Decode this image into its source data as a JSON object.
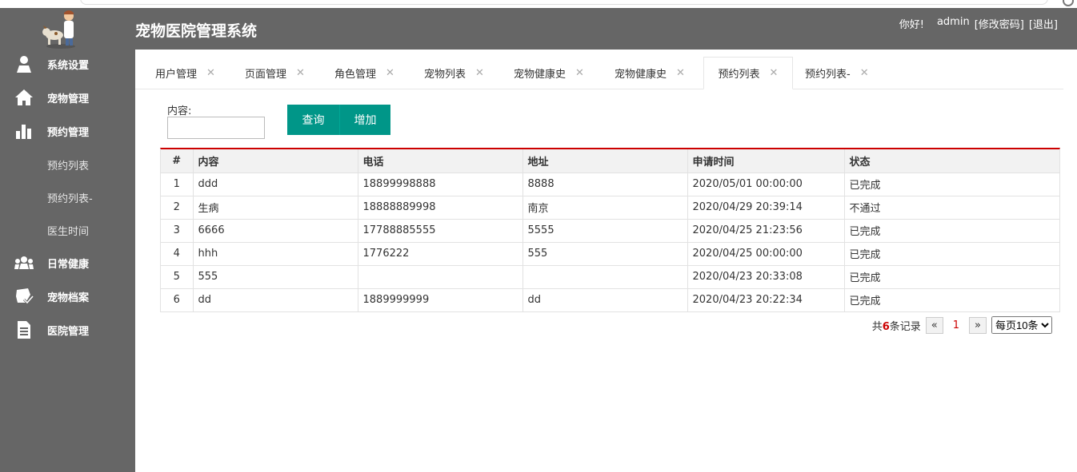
{
  "app": {
    "title": "宠物医院管理系统"
  },
  "header": {
    "greeting": "你好!",
    "username": "admin",
    "change_password": "[修改密码]",
    "logout": "[退出]"
  },
  "sidebar": {
    "items": [
      {
        "label": "系统设置",
        "icon": "user-icon"
      },
      {
        "label": "宠物管理",
        "icon": "home-icon"
      },
      {
        "label": "预约管理",
        "icon": "bar-chart-icon"
      },
      {
        "label": "预约列表"
      },
      {
        "label": "预约列表-"
      },
      {
        "label": "医生时间"
      },
      {
        "label": "日常健康",
        "icon": "users-icon"
      },
      {
        "label": "宠物档案",
        "icon": "paw-check-icon"
      },
      {
        "label": "医院管理",
        "icon": "document-icon"
      }
    ]
  },
  "tabs": [
    {
      "label": "用户管理"
    },
    {
      "label": "页面管理"
    },
    {
      "label": "角色管理"
    },
    {
      "label": "宠物列表"
    },
    {
      "label": "宠物健康史"
    },
    {
      "label": "宠物健康史"
    },
    {
      "label": "预约列表",
      "active": true
    },
    {
      "label": "预约列表-"
    }
  ],
  "search": {
    "label": "内容:",
    "value": "",
    "query_button": "查询",
    "add_button": "增加"
  },
  "table": {
    "headers": [
      "#",
      "内容",
      "电话",
      "地址",
      "申请时间",
      "状态"
    ],
    "rows": [
      [
        "1",
        "ddd",
        "18899998888",
        "8888",
        "2020/05/01 00:00:00",
        "已完成"
      ],
      [
        "2",
        "生病",
        "18888889998",
        "南京",
        "2020/04/29 20:39:14",
        "不通过"
      ],
      [
        "3",
        "6666",
        "17788885555",
        "5555",
        "2020/04/25 21:23:56",
        "已完成"
      ],
      [
        "4",
        "hhh",
        "1776222",
        "555",
        "2020/04/25 00:00:00",
        "已完成"
      ],
      [
        "5",
        "555",
        "",
        "",
        "2020/04/23 20:33:08",
        "已完成"
      ],
      [
        "6",
        "dd",
        "1889999999",
        "dd",
        "2020/04/23 20:22:34",
        "已完成"
      ]
    ]
  },
  "pager": {
    "prefix": "共",
    "total": "6",
    "suffix": "条记录",
    "prev": "«",
    "current": "1",
    "next": "»",
    "page_size": "每页10条"
  },
  "colors": {
    "sidebar": "#666666",
    "accent": "#009688",
    "highlight": "#cc0000"
  }
}
